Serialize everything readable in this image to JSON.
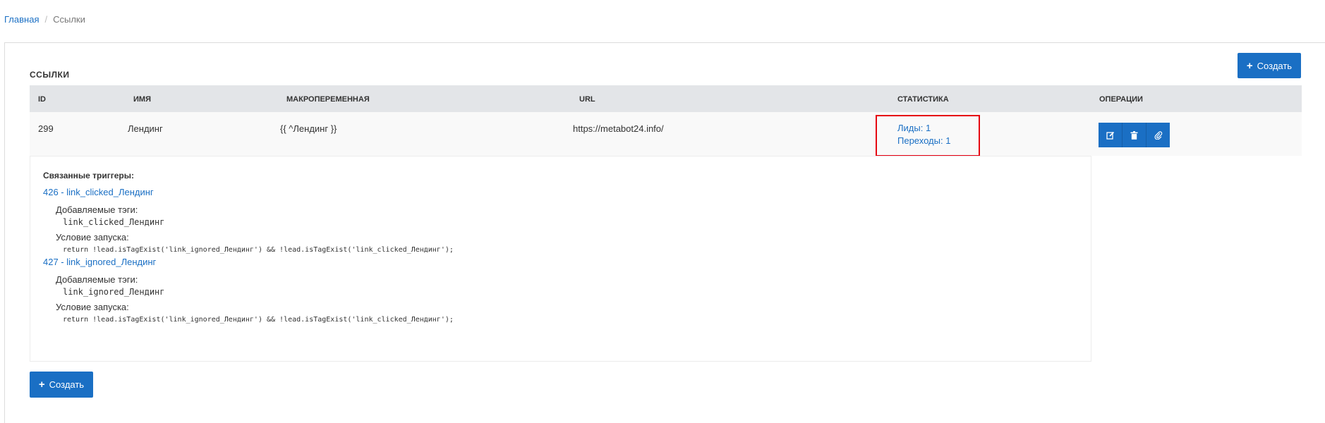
{
  "breadcrumb": {
    "home": "Главная",
    "separator": "/",
    "current": "Ссылки"
  },
  "page": {
    "section_title": "ССЫЛКИ",
    "create_label": "Создать"
  },
  "table": {
    "headers": [
      "ID",
      "ИМЯ",
      "МАКРОПЕРЕМЕННАЯ",
      "URL",
      "СТАТИСТИКА",
      "ОПЕРАЦИИ"
    ],
    "rows": [
      {
        "id": "299",
        "name": "Лендинг",
        "macro": "{{ ^Лендинг }}",
        "url": "https://metabot24.info/",
        "stats": {
          "leads": "Лиды: 1",
          "clicks": "Переходы: 1"
        },
        "operations": [
          "edit-icon",
          "trash-icon",
          "link-icon"
        ]
      }
    ]
  },
  "details": {
    "title": "Связанные триггеры:",
    "triggers": [
      {
        "link": "426 - link_clicked_Лендинг",
        "tags_label": "Добавляемые тэги:",
        "tags": "link_clicked_Лендинг",
        "condition_label": "Условие запуска:",
        "condition": "return !lead.isTagExist('link_ignored_Лендинг') && !lead.isTagExist('link_clicked_Лендинг');"
      },
      {
        "link": "427 - link_ignored_Лендинг",
        "tags_label": "Добавляемые тэги:",
        "tags": "link_ignored_Лендинг",
        "condition_label": "Условие запуска:",
        "condition": "return !lead.isTagExist('link_ignored_Лендинг') && !lead.isTagExist('link_clicked_Лендинг');"
      }
    ]
  },
  "colors": {
    "accent": "#1a6fc4",
    "highlight": "#e60012",
    "table_header_bg": "#e3e5e8"
  }
}
